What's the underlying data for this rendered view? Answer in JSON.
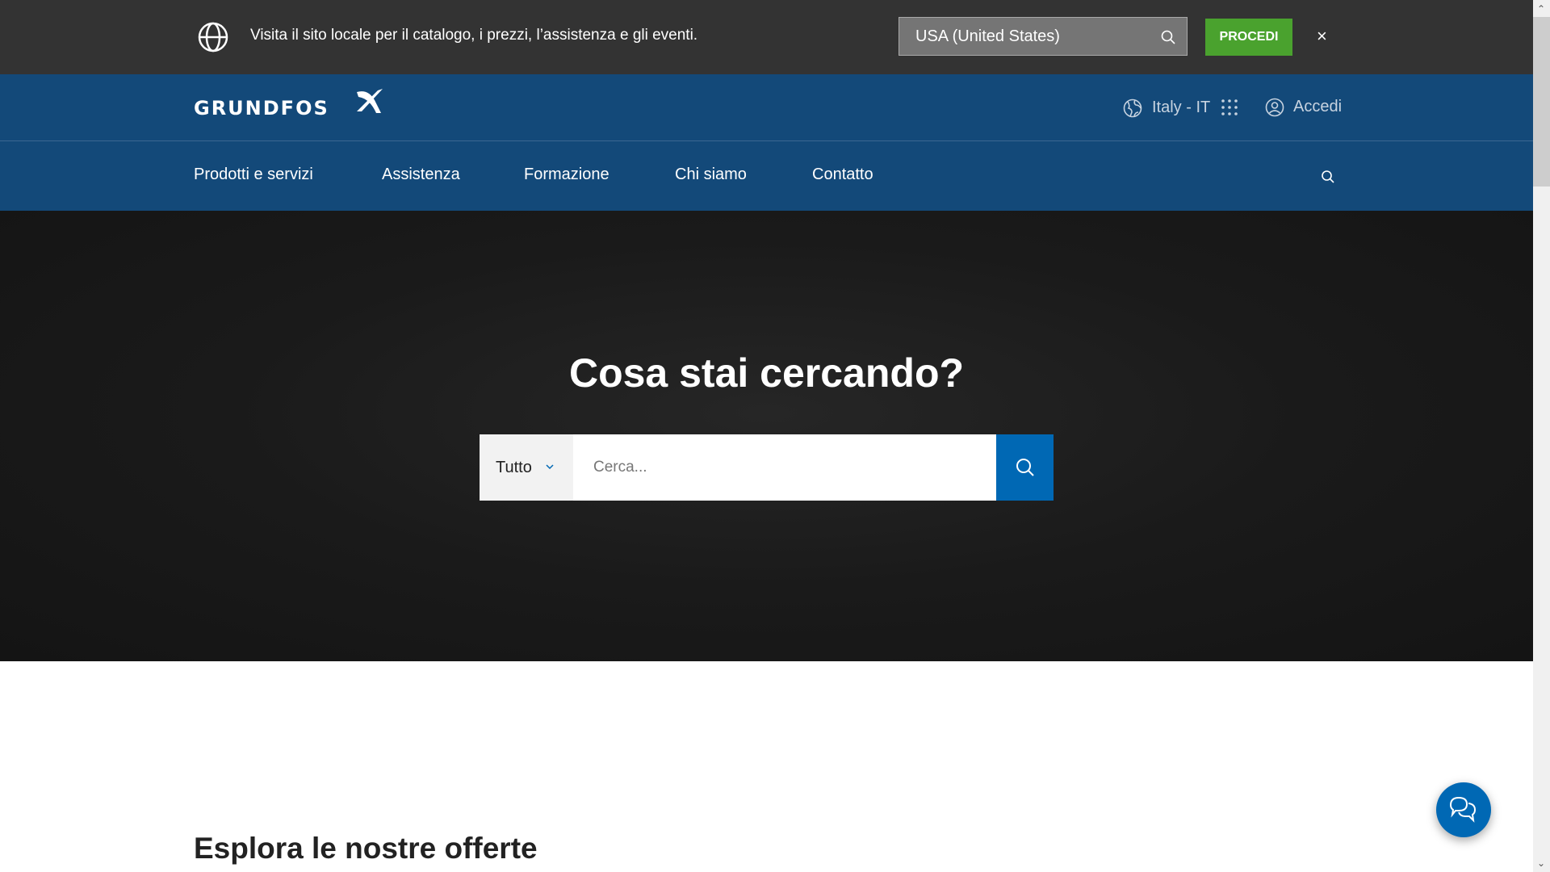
{
  "locale_banner": {
    "message": "Visita il sito locale per il catalogo, i prezzi, l’assistenza e gli eventi.",
    "country_value": "USA (United States)",
    "proceed_label": "PROCEDI",
    "close_label": "×",
    "icons": [
      "globe-icon",
      "search-icon",
      "close-icon"
    ]
  },
  "header": {
    "logo": "GRUNDFOS",
    "region_label": "Italy - IT",
    "login_label": "Accedi"
  },
  "nav": {
    "items": [
      {
        "label": "Prodotti e servizi"
      },
      {
        "label": "Assistenza"
      },
      {
        "label": "Formazione"
      },
      {
        "label": "Chi siamo"
      },
      {
        "label": "Contatto"
      }
    ]
  },
  "hero": {
    "title": "Cosa stai cercando?",
    "category_selected": "Tutto",
    "search_placeholder": "Cerca..."
  },
  "section": {
    "title": "Esplora le nostre offerte"
  },
  "colors": {
    "banner_bg": "#333333",
    "brand_blue": "#134979",
    "accent_blue": "#0068b4",
    "proceed_green": "#4aa22e",
    "hero_bg": "#1a1a1a"
  }
}
